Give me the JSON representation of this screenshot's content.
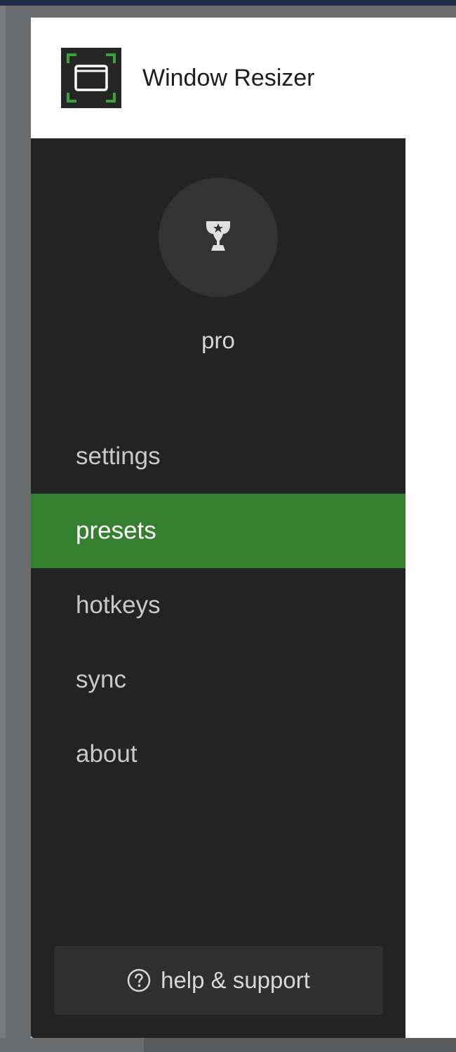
{
  "app": {
    "title": "Window Resizer",
    "logo_icon": "window-resize-icon",
    "accent_color": "#35802e"
  },
  "profile": {
    "icon": "trophy-icon",
    "label": "pro"
  },
  "nav": {
    "items": [
      {
        "label": "settings",
        "active": false
      },
      {
        "label": "presets",
        "active": true
      },
      {
        "label": "hotkeys",
        "active": false
      },
      {
        "label": "sync",
        "active": false
      },
      {
        "label": "about",
        "active": false
      }
    ]
  },
  "help": {
    "icon": "question-circle-icon",
    "label": "help & support"
  }
}
